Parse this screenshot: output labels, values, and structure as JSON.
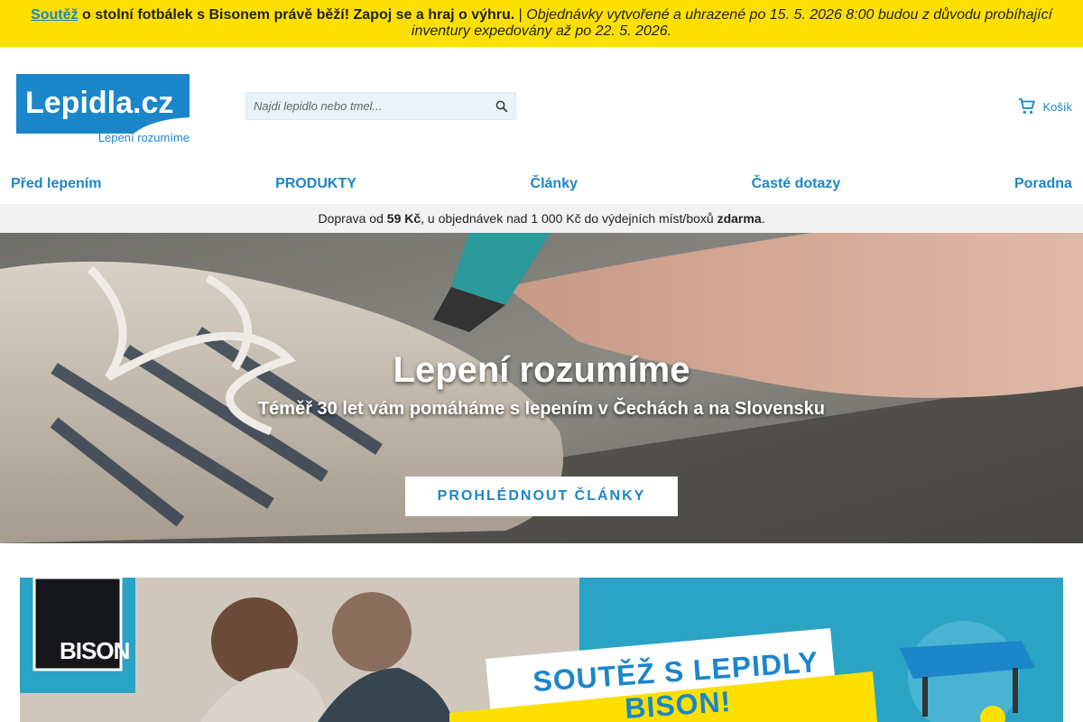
{
  "announcement": {
    "link": "Soutěž",
    "bold_text": "o stolní fotbálek s Bisonem právě běží! Zapoj se a hraj o výhru.",
    "separator": "|",
    "italic_text": "Objednávky vytvořené a uhrazené po 15. 5. 2026 8:00 budou z důvodu probíhající inventury expedovány až po 22. 5. 2026."
  },
  "header": {
    "logo_text": "Lepidla.cz",
    "tagline": "Lepení rozumíme",
    "search_placeholder": "Najdi lepidlo nebo tmel...",
    "search_icon": "search-icon",
    "cart_label": "Košík",
    "cart_icon": "cart-icon"
  },
  "nav": {
    "items": [
      "Před lepením",
      "PRODUKTY",
      "Články",
      "Časté dotazy",
      "Poradna"
    ]
  },
  "shipping": {
    "prefix": "Doprava od ",
    "price": "59 Kč",
    "middle": ", u objednávek nad 1 000 Kč do výdejních míst/boxů ",
    "free": "zdarma",
    "suffix": "."
  },
  "hero": {
    "title": "Lepení rozumíme",
    "subtitle": "Téměř 30 let vám pomáháme s lepením v Čechách a na Slovensku",
    "button": "PROHLÉDNOUT ČLÁNKY"
  },
  "promo": {
    "brand": "BISON",
    "headline": "SOUTĚŽ S LEPIDLY BISON!"
  },
  "colors": {
    "brand_blue": "#1b86c9",
    "announce_yellow": "#fde000",
    "promo_teal": "#2a9fc0"
  }
}
